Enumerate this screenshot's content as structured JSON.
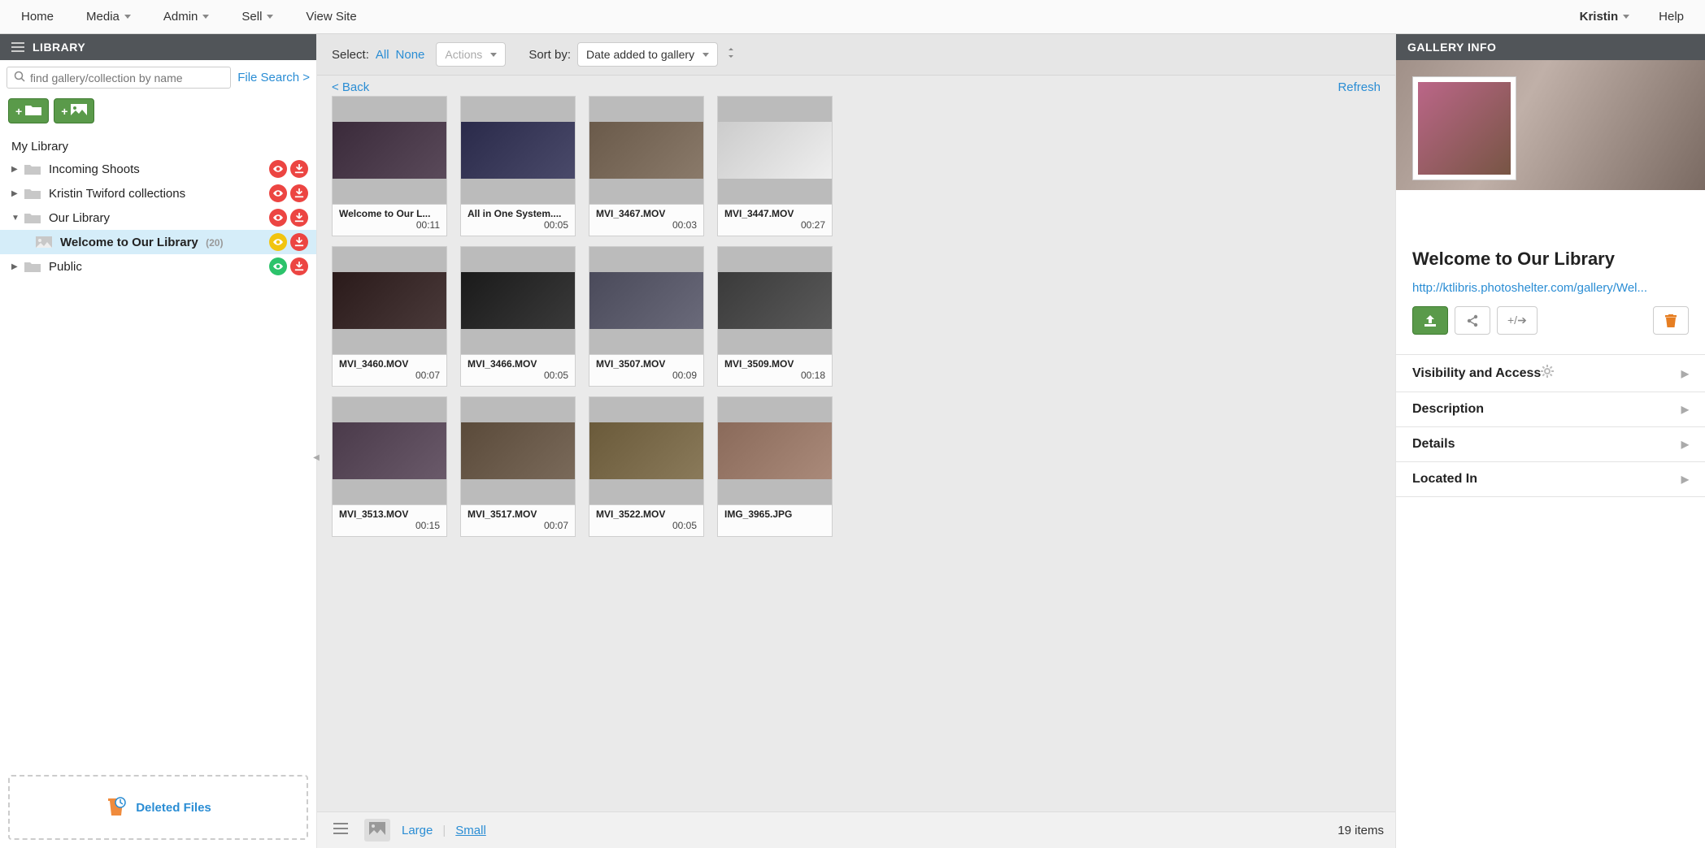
{
  "topnav": {
    "items": [
      "Home",
      "Media",
      "Admin",
      "Sell",
      "View Site"
    ],
    "has_caret": [
      false,
      true,
      true,
      true,
      false
    ],
    "user": "Kristin",
    "help": "Help"
  },
  "left": {
    "header": "LIBRARY",
    "search_placeholder": "find gallery/collection by name",
    "file_search": "File Search >",
    "section_label": "My Library",
    "tree": [
      {
        "label": "Incoming Shoots",
        "expanded": false,
        "badges": [
          "red-eye",
          "red-dl"
        ]
      },
      {
        "label": "Kristin Twiford collections",
        "expanded": false,
        "badges": [
          "red-eye",
          "red-dl"
        ]
      },
      {
        "label": "Our Library",
        "expanded": true,
        "badges": [
          "red-eye",
          "red-dl"
        ],
        "children": [
          {
            "label": "Welcome to Our Library",
            "count": "(20)",
            "badges": [
              "yellow-eye",
              "red-dl"
            ],
            "selected": true
          }
        ]
      },
      {
        "label": "Public",
        "expanded": false,
        "badges": [
          "green-eye",
          "red-dl"
        ]
      }
    ],
    "deleted": "Deleted Files"
  },
  "center": {
    "select_label": "Select:",
    "select_all": "All",
    "select_none": "None",
    "actions": "Actions",
    "sort_label": "Sort by:",
    "sort_value": "Date added to gallery",
    "back": "< Back",
    "refresh": "Refresh",
    "items": [
      {
        "name": "Welcome to Our L...",
        "dur": "00:11"
      },
      {
        "name": "All in One System....",
        "dur": "00:05"
      },
      {
        "name": "MVI_3467.MOV",
        "dur": "00:03"
      },
      {
        "name": "MVI_3447.MOV",
        "dur": "00:27"
      },
      {
        "name": "MVI_3460.MOV",
        "dur": "00:07"
      },
      {
        "name": "MVI_3466.MOV",
        "dur": "00:05"
      },
      {
        "name": "MVI_3507.MOV",
        "dur": "00:09"
      },
      {
        "name": "MVI_3509.MOV",
        "dur": "00:18"
      },
      {
        "name": "MVI_3513.MOV",
        "dur": "00:15"
      },
      {
        "name": "MVI_3517.MOV",
        "dur": "00:07"
      },
      {
        "name": "MVI_3522.MOV",
        "dur": "00:05"
      },
      {
        "name": "IMG_3965.JPG",
        "dur": ""
      }
    ],
    "size_large": "Large",
    "size_small": "Small",
    "item_count": "19 items"
  },
  "right": {
    "header": "GALLERY INFO",
    "title": "Welcome to Our Library",
    "url": "http://ktlibris.photoshelter.com/gallery/Wel...",
    "sections": [
      "Visibility and Access",
      "Description",
      "Details",
      "Located In"
    ]
  }
}
